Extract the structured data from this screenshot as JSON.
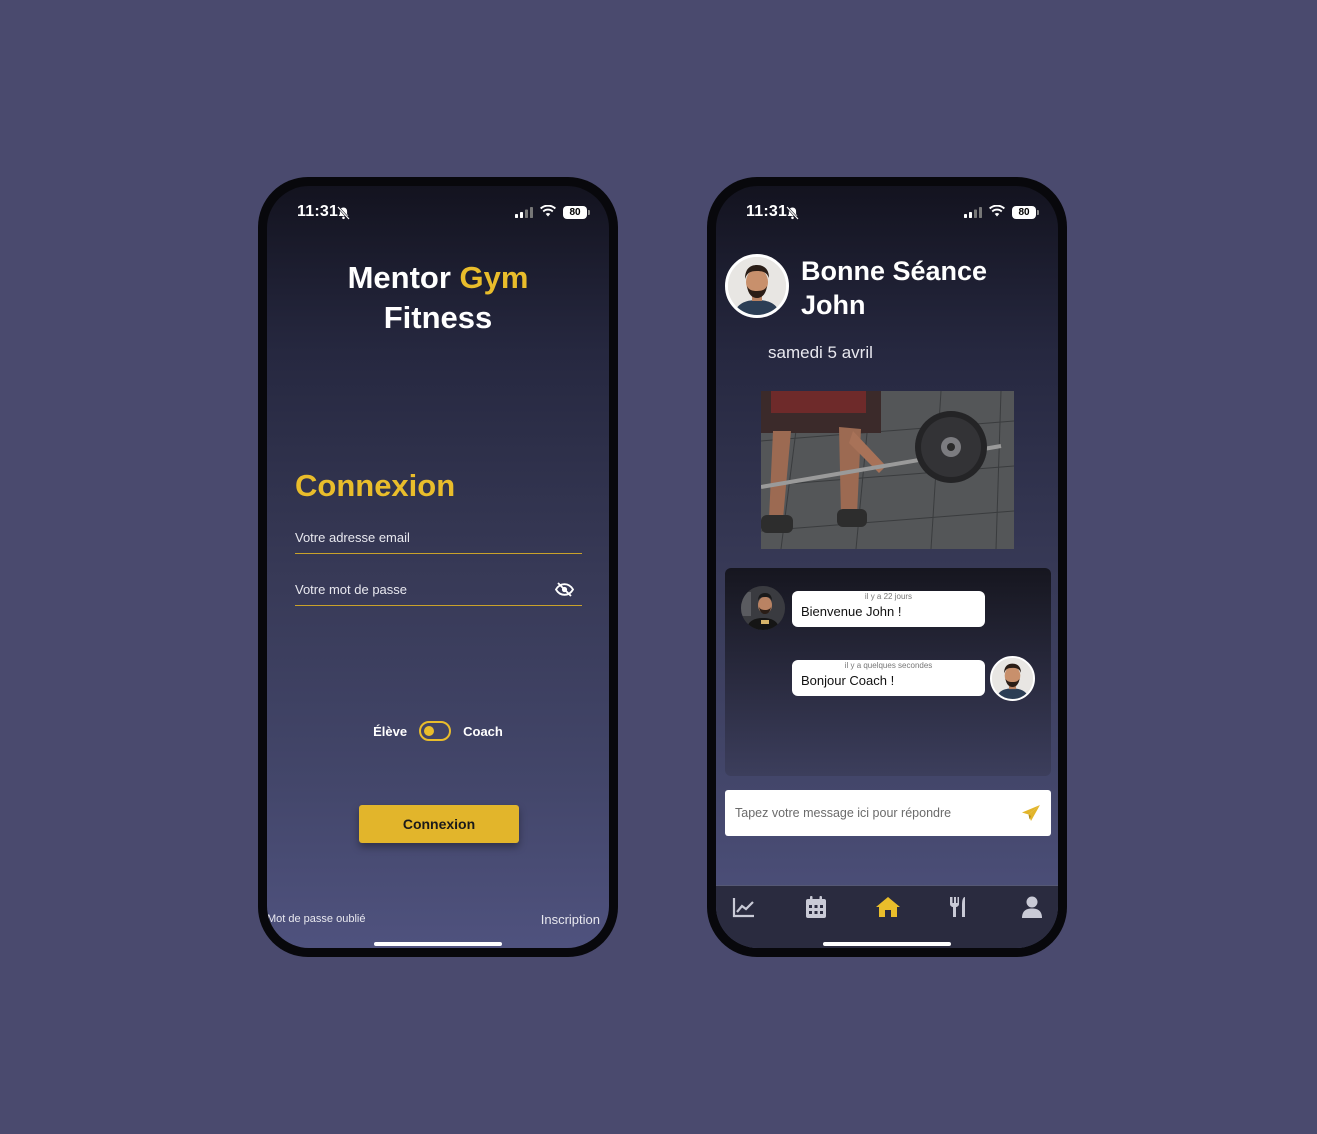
{
  "status_bar": {
    "time": "11:31",
    "battery": "80"
  },
  "login": {
    "brand_part1": "Mentor",
    "brand_accent": "Gym",
    "brand_line2": "Fitness",
    "title": "Connexion",
    "email_placeholder": "Votre adresse email",
    "password_placeholder": "Votre mot de passe",
    "role_student": "Élève",
    "role_coach": "Coach",
    "submit_label": "Connexion",
    "forgot_password": "Mot de passe oublié",
    "signup": "Inscription"
  },
  "home": {
    "greeting_line1": "Bonne Séance",
    "greeting_line2": "John",
    "date": "samedi 5 avril",
    "messages": [
      {
        "time_ago": "il y a 22 jours",
        "text": "Bienvenue John !"
      },
      {
        "time_ago": "il y a quelques secondes",
        "text": "Bonjour Coach !"
      }
    ],
    "reply_placeholder": "Tapez votre message ici pour répondre",
    "tabs": [
      {
        "icon": "chart-line-icon"
      },
      {
        "icon": "calendar-icon"
      },
      {
        "icon": "home-icon",
        "active": true
      },
      {
        "icon": "utensils-icon"
      },
      {
        "icon": "user-icon"
      }
    ]
  },
  "colors": {
    "background": "#4a4a6e",
    "accent": "#e9bd2b",
    "tab_active": "#e9bd2b",
    "tab_inactive": "#c9cad6"
  }
}
